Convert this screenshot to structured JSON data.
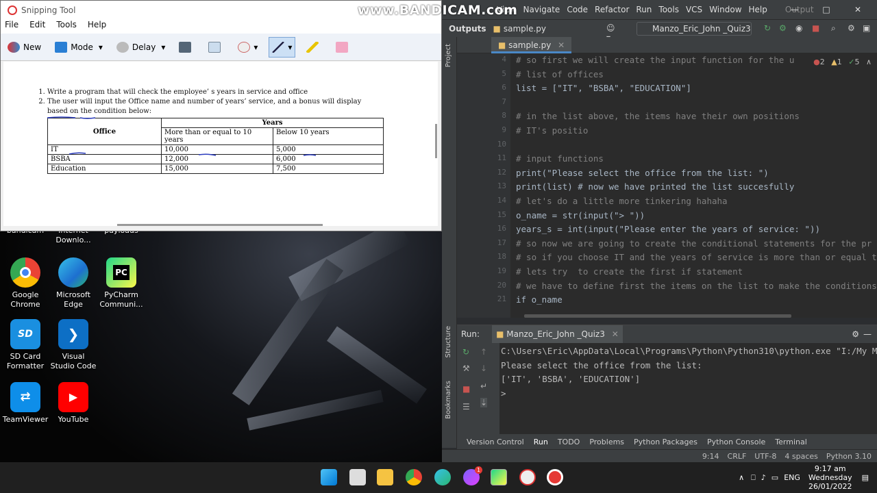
{
  "watermark": "www.BANDICAM.com",
  "snipping": {
    "title": "Snipping Tool",
    "menu": [
      "File",
      "Edit",
      "Tools",
      "Help"
    ],
    "toolbar": {
      "new": "New",
      "mode": "Mode",
      "delay": "Delay"
    },
    "doc": {
      "item1": "Write a program that will check the employee’ s years in service and office",
      "item2": "The user will input the Office name and number of years’ service, and a bonus will display based on the condition below:",
      "table": {
        "office_header": "Office",
        "years_header": "Years",
        "col1": "More than or equal to 10 years",
        "col2": "Below 10 years",
        "rows": [
          {
            "office": "IT",
            "a": "10,000",
            "b": "5,000"
          },
          {
            "office": "BSBA",
            "a": "12,000",
            "b": "6,000"
          },
          {
            "office": "Education",
            "a": "15,000",
            "b": "7,500"
          }
        ]
      }
    }
  },
  "desktop": {
    "partial_labels": [
      "bandicam",
      "Internet Downlo...",
      "payloads"
    ],
    "icons": [
      {
        "label": "Google Chrome"
      },
      {
        "label": "Microsoft Edge"
      },
      {
        "label": "PyCharm Communi..."
      },
      {
        "label": "SD Card Formatter"
      },
      {
        "label": "Visual Studio Code"
      },
      {
        "label": "TeamViewer"
      },
      {
        "label": "YouTube"
      }
    ]
  },
  "ide": {
    "menu": [
      "View",
      "Navigate",
      "Code",
      "Refactor",
      "Run",
      "Tools",
      "VCS",
      "Window",
      "Help"
    ],
    "menu_extra": "Output",
    "breadcrumb": {
      "root": "Outputs",
      "file": "sample.py"
    },
    "run_config": "Manzo_Eric_John _Quiz3",
    "project_label": "Project",
    "structure_label": "Structure",
    "bookmarks_label": "Bookmarks",
    "tab": "sample.py",
    "inspections": {
      "errors": "2",
      "warnings": "1",
      "weak": "5"
    },
    "line_numbers": [
      "4",
      "5",
      "6",
      "7",
      "8",
      "9",
      "10",
      "11",
      "12",
      "13",
      "14",
      "15",
      "16",
      "17",
      "18",
      "19",
      "20",
      "21"
    ],
    "code": [
      "# so first we will create the input function for the u",
      "# list of offices",
      "list = [\"IT\", \"BSBA\", \"EDUCATION\"]",
      "",
      "# in the list above, the items have their own positions",
      "# IT's positio",
      "",
      "# input functions",
      "print(\"Please select the office from the list: \")",
      "print(list) # now we have printed the list succesfully",
      "# let's do a little more tinkering hahaha",
      "o_name = str(input(\"> \"))",
      "years_s = int(input(\"Please enter the years of service: \"))",
      "# so now we are going to create the conditional statements for the pr",
      "# so if you choose IT and the years of service is more than or equal t",
      "# lets try  to create the first if statement",
      "# we have to define first the items on the list to make the conditions",
      "if o_name"
    ],
    "run": {
      "label": "Run:",
      "tab": "Manzo_Eric_John _Quiz3",
      "output": [
        "C:\\Users\\Eric\\AppData\\Local\\Programs\\Python\\Python310\\python.exe \"I:/My M",
        "Please select the office from the list: ",
        "['IT', 'BSBA', 'EDUCATION']",
        ">"
      ]
    },
    "bottom_tabs": [
      "Version Control",
      "Run",
      "TODO",
      "Problems",
      "Python Packages",
      "Python Console",
      "Terminal"
    ],
    "status": {
      "pos": "9:14",
      "eol": "CRLF",
      "enc": "UTF-8",
      "indent": "4 spaces",
      "interp": "Python 3.10"
    }
  },
  "taskbar": {
    "lang": "ENG",
    "time": "9:17 am",
    "day": "Wednesday",
    "date": "26/01/2022",
    "notif_badge": "1"
  }
}
